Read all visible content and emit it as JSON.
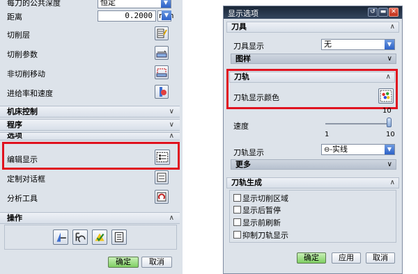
{
  "left_panel": {
    "top_row_label": "每刀的公共深度",
    "top_row_value": "恒定",
    "distance_label": "距离",
    "distance_value": "0.2000",
    "distance_unit": "mm",
    "rows": [
      {
        "label": "切削层",
        "icon": "cut-levels-icon"
      },
      {
        "label": "切削参数",
        "icon": "cutting-params-icon"
      },
      {
        "label": "非切削移动",
        "icon": "non-cutting-moves-icon"
      },
      {
        "label": "进给率和速度",
        "icon": "feeds-speeds-icon"
      }
    ],
    "sections": {
      "machine_control": "机床控制",
      "program": "程序",
      "options": "选项",
      "actions": "操作"
    },
    "option_rows": [
      {
        "label": "编辑显示",
        "icon": "edit-display-icon"
      },
      {
        "label": "定制对话框",
        "icon": "customize-dialog-icon"
      },
      {
        "label": "分析工具",
        "icon": "analysis-tool-icon"
      }
    ],
    "action_icons": [
      "generate-icon",
      "replay-icon",
      "verify-icon",
      "list-icon"
    ],
    "ok_label": "确定",
    "cancel_label": "取消"
  },
  "dialog": {
    "title": "显示选项",
    "tool_section": "刀具",
    "tool_display_label": "刀具显示",
    "tool_display_value": "无",
    "pattern_label": "图样",
    "path_section": "刀轨",
    "path_color_label": "刀轨显示颜色",
    "speed_label": "速度",
    "speed_value": 10,
    "speed_min": "1",
    "speed_max": "10",
    "speed_top": "10",
    "path_display_label": "刀轨显示",
    "path_display_value": "实线",
    "more_label": "更多",
    "gen_section": "刀轨生成",
    "checkboxes": [
      "显示切削区域",
      "显示后暂停",
      "显示前刷新",
      "抑制刀轨显示"
    ],
    "ok_label": "确定",
    "apply_label": "应用",
    "cancel_label": "取消"
  }
}
